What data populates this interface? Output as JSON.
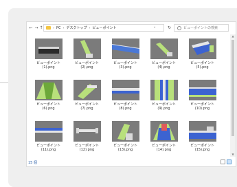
{
  "window": {
    "nav": {
      "back": "←",
      "forward": "→",
      "up": "↑"
    },
    "breadcrumb": [
      "PC",
      "デスクトップ",
      "ビューポイント"
    ],
    "breadcrumb_sep": "›",
    "dropdown": "⌄",
    "refresh": "↻",
    "search_placeholder": "ビューポイントの検索"
  },
  "files": [
    {
      "name": "ビューポイント",
      "file": "(1).png",
      "icon": "image-thumbnail"
    },
    {
      "name": "ビューポイント",
      "file": "(2).png",
      "icon": "image-thumbnail"
    },
    {
      "name": "ビューポイント",
      "file": "(3).png",
      "icon": "image-thumbnail"
    },
    {
      "name": "ビューポイント",
      "file": "(4).png",
      "icon": "image-thumbnail"
    },
    {
      "name": "ビューポイント",
      "file": "(5).png",
      "icon": "image-thumbnail"
    },
    {
      "name": "ビューポイント",
      "file": "(6).png",
      "icon": "image-thumbnail"
    },
    {
      "name": "ビューポイント",
      "file": "(7).png",
      "icon": "image-thumbnail"
    },
    {
      "name": "ビューポイント",
      "file": "(8).png",
      "icon": "image-thumbnail"
    },
    {
      "name": "ビューポイント",
      "file": "(9).png",
      "icon": "image-thumbnail"
    },
    {
      "name": "ビューポイント",
      "file": "(10).png",
      "icon": "image-thumbnail"
    },
    {
      "name": "ビューポイント",
      "file": "(11).png",
      "icon": "image-thumbnail"
    },
    {
      "name": "ビューポイント",
      "file": "(12).png",
      "icon": "image-thumbnail"
    },
    {
      "name": "ビューポイント",
      "file": "(13).png",
      "icon": "image-thumbnail"
    },
    {
      "name": "ビューポイント",
      "file": "(14).png",
      "icon": "image-thumbnail"
    },
    {
      "name": "ビューポイント",
      "file": "(15).png",
      "icon": "image-thumbnail"
    }
  ],
  "status": {
    "text": "15 個"
  },
  "colors": {
    "thumb_bg": "#7b7b7b",
    "accent": "#5b9bd5",
    "folder": "#f4c542"
  }
}
